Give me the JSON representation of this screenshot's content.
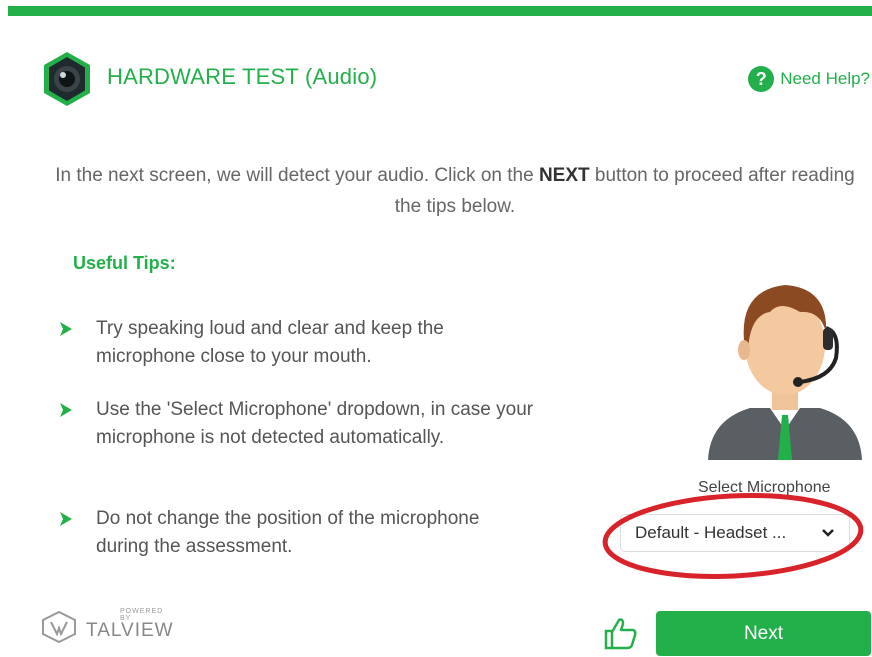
{
  "header": {
    "title": "HARDWARE TEST (Audio)",
    "help_label": "Need Help?",
    "help_icon": "question-circle-icon"
  },
  "intro": {
    "text_before": "In the next screen, we will detect your audio. Click on the ",
    "text_bold": "NEXT",
    "text_after": " button to proceed after reading the tips below."
  },
  "tips": {
    "title": "Useful Tips:",
    "items": [
      "Try speaking loud and clear and keep the microphone close to your mouth.",
      "Use the 'Select Microphone' dropdown, in case your microphone is not detected automatically.",
      "Do not change the position of the microphone during the assessment."
    ]
  },
  "microphone": {
    "label": "Select Microphone",
    "selected": "Default - Headset ..."
  },
  "footer": {
    "powered_by": "POWERED BY",
    "brand": "TALVIEW",
    "next_label": "Next"
  },
  "colors": {
    "accent": "#23b04b",
    "highlight": "#d8232a"
  }
}
